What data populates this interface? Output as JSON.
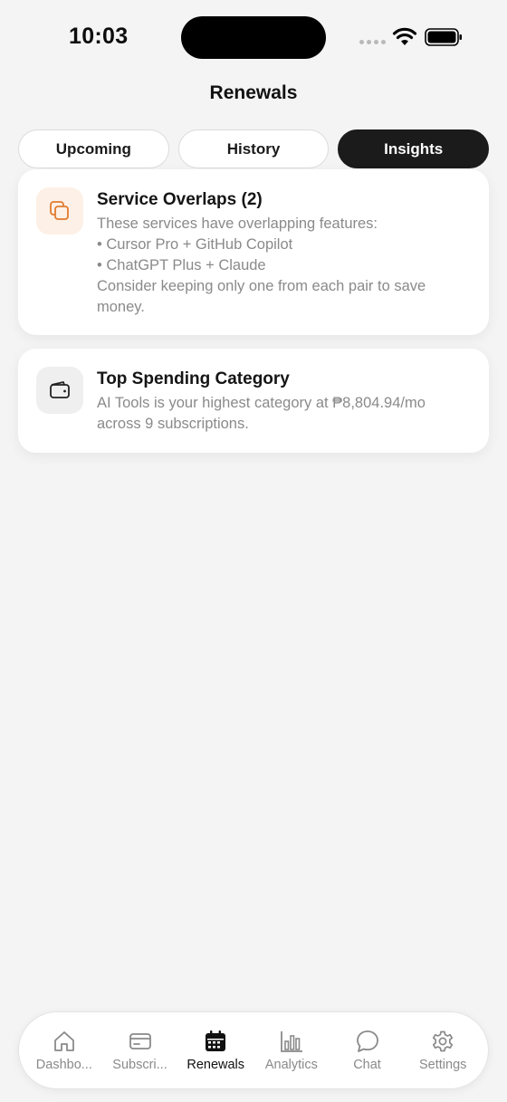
{
  "status_bar": {
    "time": "10:03"
  },
  "header": {
    "title": "Renewals"
  },
  "tabs": [
    {
      "label": "Upcoming",
      "active": false
    },
    {
      "label": "History",
      "active": false
    },
    {
      "label": "Insights",
      "active": true
    }
  ],
  "insights": [
    {
      "icon": "overlap-copy-icon",
      "title": "Service Overlaps (2)",
      "lines": [
        "These services have overlapping features:",
        "• Cursor Pro + GitHub Copilot",
        "• ChatGPT Plus + Claude",
        "Consider keeping only one from each pair to save",
        "money."
      ],
      "accent": "#e07b2e"
    },
    {
      "icon": "wallet-icon",
      "title": "Top Spending Category",
      "lines": [
        "AI Tools is your highest category at ₱8,804.94/mo",
        "across 9 subscriptions."
      ]
    }
  ],
  "nav": [
    {
      "label": "Dashbo...",
      "icon": "home-icon",
      "active": false
    },
    {
      "label": "Subscri...",
      "icon": "card-icon",
      "active": false
    },
    {
      "label": "Renewals",
      "icon": "calendar-icon",
      "active": true
    },
    {
      "label": "Analytics",
      "icon": "bar-chart-icon",
      "active": false
    },
    {
      "label": "Chat",
      "icon": "chat-bubble-icon",
      "active": false
    },
    {
      "label": "Settings",
      "icon": "gear-icon",
      "active": false
    }
  ]
}
